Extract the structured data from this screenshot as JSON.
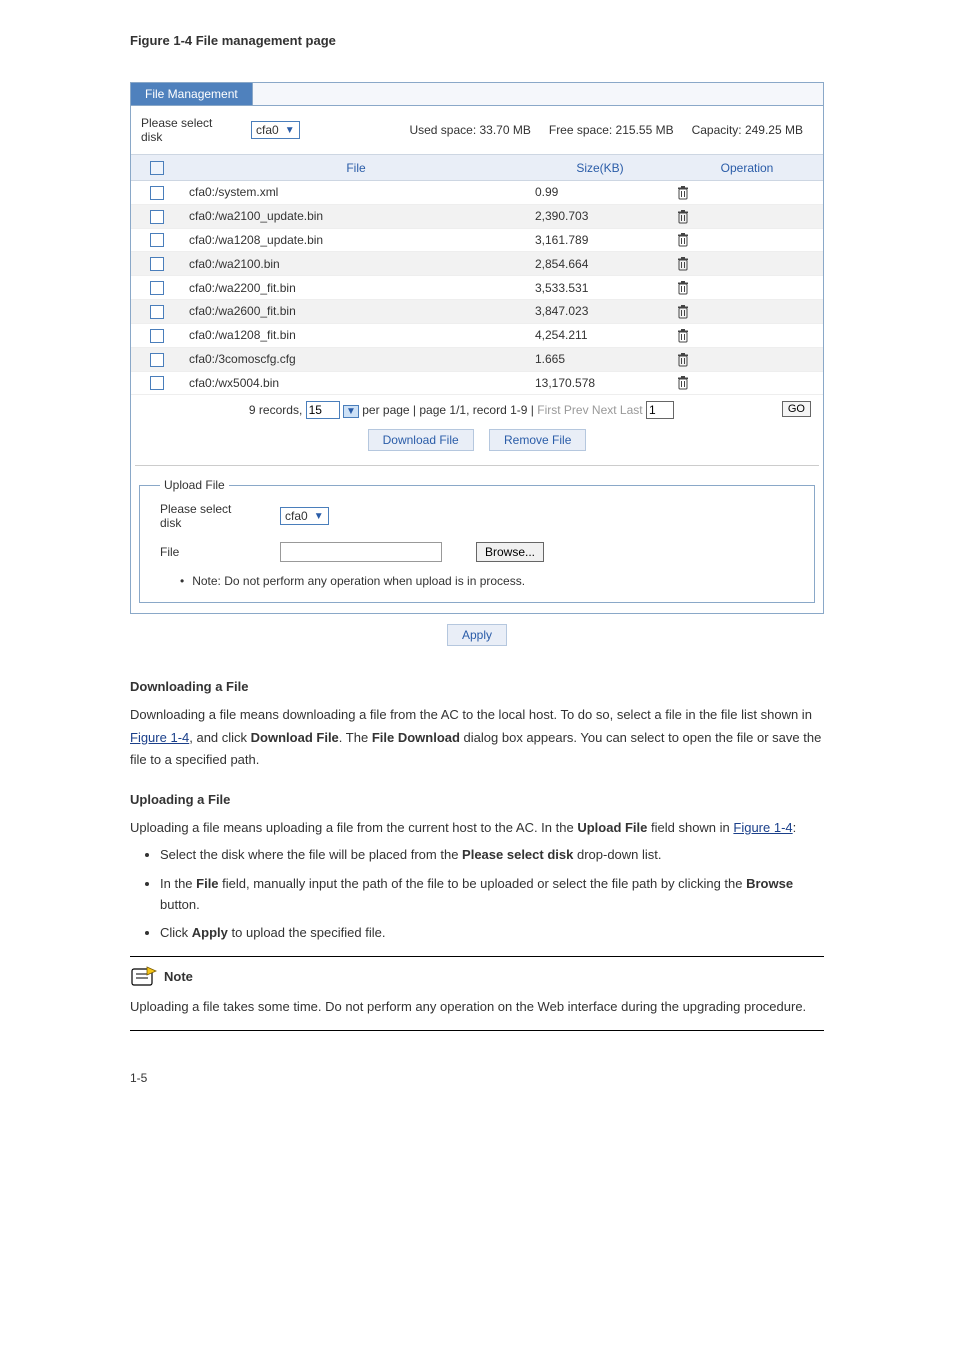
{
  "caption1": "Figure 1-4 File management page",
  "tabLabel": "File Management",
  "selectDiskLabel": "Please select disk",
  "diskValue": "cfa0",
  "usedSpace": "Used space: 33.70 MB",
  "freeSpace": "Free space: 215.55 MB",
  "capacity": "Capacity: 249.25 MB",
  "thFile": "File",
  "thSize": "Size(KB)",
  "thOp": "Operation",
  "files": [
    {
      "name": "cfa0:/system.xml",
      "size": "0.99"
    },
    {
      "name": "cfa0:/wa2100_update.bin",
      "size": "2,390.703"
    },
    {
      "name": "cfa0:/wa1208_update.bin",
      "size": "3,161.789"
    },
    {
      "name": "cfa0:/wa2100.bin",
      "size": "2,854.664"
    },
    {
      "name": "cfa0:/wa2200_fit.bin",
      "size": "3,533.531"
    },
    {
      "name": "cfa0:/wa2600_fit.bin",
      "size": "3,847.023"
    },
    {
      "name": "cfa0:/wa1208_fit.bin",
      "size": "4,254.211"
    },
    {
      "name": "cfa0:/3comoscfg.cfg",
      "size": "1.665"
    },
    {
      "name": "cfa0:/wx5004.bin",
      "size": "13,170.578"
    }
  ],
  "pagerRecords": "9 records,",
  "pagerPerPage": "15",
  "pagerMid": "per page | page 1/1, record 1-9 |",
  "pagerNav": "First  Prev  Next  Last",
  "pagerPageNum": "1",
  "pagerGo": "GO",
  "btnDownload": "Download File",
  "btnRemove": "Remove File",
  "uploadLegend": "Upload File",
  "uploadDiskLabel": "Please select disk",
  "uploadDiskValue": "cfa0",
  "uploadFileLabel": "File",
  "browse": "Browse...",
  "uploadNote": "Note: Do not perform any operation when upload is in process.",
  "apply": "Apply",
  "doc": {
    "downloadHeading": "Downloading a File",
    "downloadPara1a": "Downloading a file means downloading a file from the AC to the local host. To do so, select a file in the file list shown in ",
    "downloadLink1": "Figure 1-4",
    "downloadPara1b": ", and click ",
    "downloadBold": "Download File",
    "downloadPara1c": ". The ",
    "downloadBold2": "File Download",
    "downloadPara1d": " dialog box appears. You can select to open the file or save the file to a specified path.",
    "uploadHeading": "Uploading a File",
    "uploadPara1a": "Uploading a file means uploading a file from the current host to the AC. In the ",
    "uploadBold1": "Upload File",
    "uploadPara1b": " field shown in ",
    "uploadLink1": "Figure 1-4",
    "uploadPara1c": ":",
    "bullet1a": "Select the disk where the file will be placed from the ",
    "bullet1b": "Please select disk",
    "bullet1c": " drop-down list.",
    "bullet2a": "In the ",
    "bullet2b": "File",
    "bullet2c": " field, manually input the path of the file to be uploaded or select the file path by clicking the ",
    "bullet2d": "Browse",
    "bullet2e": " button.",
    "bullet3a": "Click ",
    "bullet3b": "Apply",
    "bullet3c": " to upload the specified file.",
    "noteTitle": "Note",
    "noteBody": "Uploading a file takes some time. Do not perform any operation on the Web interface during the upgrading procedure."
  },
  "footerPage": "1-5"
}
